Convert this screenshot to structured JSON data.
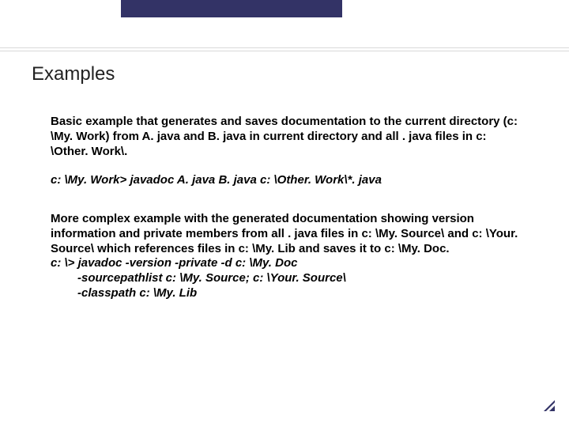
{
  "title": "Examples",
  "para1": "Basic example that generates and saves documentation to the current directory (c: \\My. Work) from A. java and B. java in current directory and all . java files in c: \\Other. Work\\.",
  "cmd1": "c: \\My. Work> javadoc A. java B. java c: \\Other. Work\\*. java",
  "para2": "More complex example with the generated documentation showing version information and private members from all . java files in c: \\My. Source\\ and c: \\Your. Source\\ which references files in c: \\My. Lib and saves it to c: \\My. Doc.",
  "cmd2_line1": "c: \\> javadoc -version -private -d c: \\My. Doc",
  "cmd2_line2": "-sourcepathlist  c: \\My. Source; c: \\Your. Source\\",
  "cmd2_line3": "-classpath c: \\My. Lib"
}
